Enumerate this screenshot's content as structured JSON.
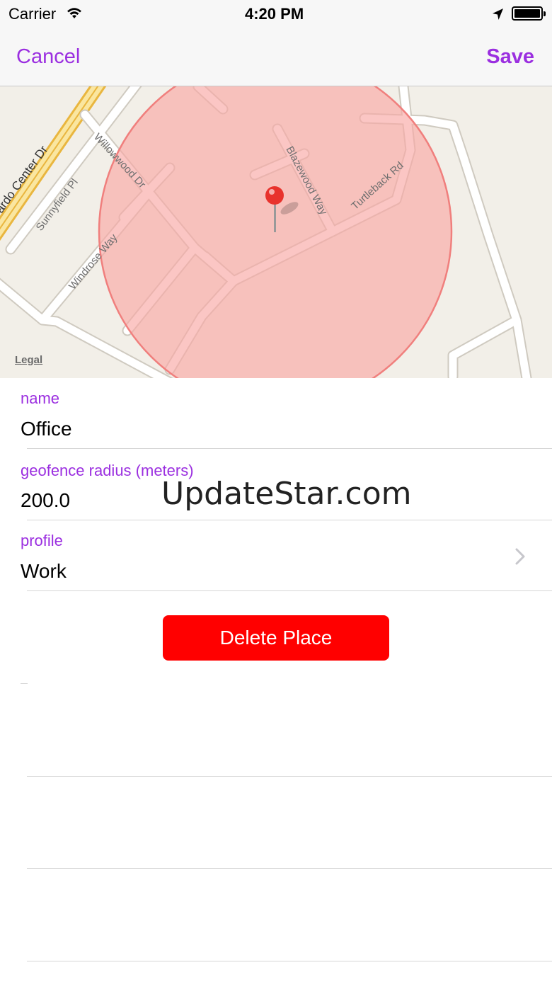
{
  "status_bar": {
    "carrier": "Carrier",
    "time": "4:20 PM"
  },
  "nav": {
    "cancel_label": "Cancel",
    "save_label": "Save"
  },
  "map": {
    "legal_label": "Legal",
    "streets": [
      "ardo Center Dr",
      "Sunnyfield Pl",
      "Willowwood Dr",
      "Windrose Way",
      "Blazewood Way",
      "Turtleback Rd"
    ]
  },
  "form": {
    "name_label": "name",
    "name_value": "Office",
    "radius_label": "geofence radius (meters)",
    "radius_value": "200.0",
    "profile_label": "profile",
    "profile_value": "Work"
  },
  "delete_label": "Delete Place",
  "watermark": "UpdateStar.com",
  "colors": {
    "accent": "#9b2fe0",
    "delete": "#ff0000",
    "geofence_fill": "#f9b3b0",
    "pin": "#e8322c"
  }
}
